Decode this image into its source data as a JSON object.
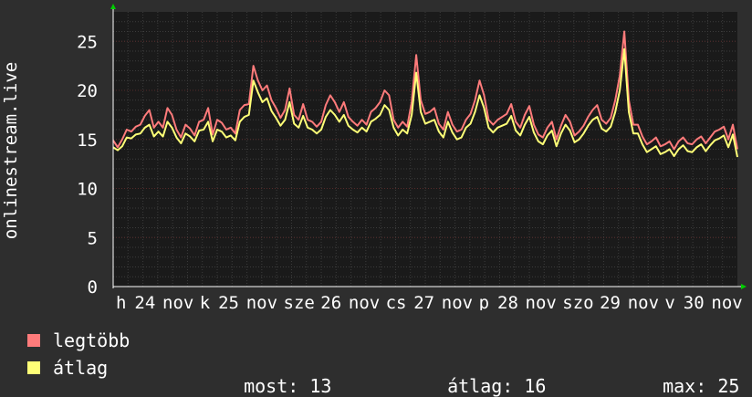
{
  "chart_data": {
    "type": "line",
    "ylabel": "onlinestream.live",
    "ylim": [
      0,
      28
    ],
    "yticks": [
      0,
      5,
      10,
      15,
      20,
      25
    ],
    "x_tick_labels": [
      "h",
      "24",
      "nov",
      "k",
      "25",
      "nov",
      "sze",
      "26",
      "nov",
      "cs",
      "27",
      "nov",
      "p",
      "28",
      "nov",
      "szo",
      "29",
      "nov",
      "v",
      "30",
      "nov"
    ],
    "grid": true,
    "colors": {
      "background": "#2e2e2e",
      "plot_area": "#1a1a1a",
      "grid": "#3c3c3c",
      "axis": "#ffffff",
      "arrow": "#00cc00"
    },
    "series": [
      {
        "name": "legtöbb",
        "color": "#ff7b7b",
        "values": [
          14.9,
          14.2,
          15.0,
          16.0,
          15.8,
          16.3,
          16.5,
          17.4,
          18.0,
          16.2,
          16.8,
          16.2,
          18.2,
          17.5,
          16.0,
          15.2,
          16.5,
          16.1,
          15.4,
          16.8,
          17.0,
          18.2,
          15.5,
          17.0,
          16.7,
          16.0,
          16.2,
          15.6,
          18.0,
          18.5,
          18.6,
          22.5,
          21.0,
          20.0,
          20.5,
          19.0,
          18.2,
          17.2,
          18.0,
          20.2,
          17.5,
          17.0,
          18.6,
          17.0,
          16.8,
          16.3,
          16.8,
          18.5,
          19.5,
          18.8,
          17.8,
          18.8,
          17.3,
          16.8,
          16.4,
          17.0,
          16.5,
          17.8,
          18.2,
          18.8,
          20.0,
          19.5,
          17.0,
          16.2,
          16.8,
          16.3,
          18.8,
          23.6,
          19.0,
          17.6,
          17.8,
          18.2,
          16.6,
          16.0,
          17.8,
          16.5,
          15.8,
          16.0,
          17.0,
          17.6,
          19.0,
          21.0,
          19.5,
          17.0,
          16.5,
          17.0,
          17.3,
          17.6,
          18.6,
          16.8,
          16.2,
          17.5,
          18.4,
          16.5,
          15.5,
          15.2,
          16.2,
          16.8,
          15.0,
          16.4,
          17.5,
          16.8,
          15.4,
          15.8,
          16.4,
          17.3,
          18.0,
          18.5,
          17.0,
          16.6,
          17.2,
          19.0,
          21.5,
          26.0,
          19.0,
          16.5,
          16.5,
          15.3,
          14.5,
          14.8,
          15.2,
          14.3,
          14.5,
          14.8,
          14.0,
          14.8,
          15.2,
          14.6,
          14.5,
          15.0,
          15.3,
          14.6,
          15.2,
          15.8,
          16.0,
          16.3,
          15.0,
          16.5,
          14.0
        ]
      },
      {
        "name": "átlag",
        "color": "#ffff77",
        "values": [
          14.2,
          13.9,
          14.3,
          15.2,
          15.1,
          15.5,
          15.6,
          16.2,
          16.5,
          15.3,
          15.8,
          15.3,
          16.8,
          16.2,
          15.2,
          14.6,
          15.6,
          15.3,
          14.8,
          15.9,
          16.0,
          16.8,
          14.8,
          16.0,
          15.8,
          15.2,
          15.4,
          14.9,
          16.8,
          17.3,
          17.5,
          21.0,
          19.8,
          18.8,
          19.2,
          17.9,
          17.2,
          16.4,
          17.0,
          18.8,
          16.6,
          16.2,
          17.4,
          16.2,
          16.0,
          15.6,
          16.0,
          17.3,
          18.0,
          17.5,
          16.8,
          17.5,
          16.4,
          16.0,
          15.7,
          16.2,
          15.8,
          16.8,
          17.1,
          17.5,
          18.5,
          18.0,
          16.2,
          15.4,
          16.0,
          15.6,
          17.5,
          21.8,
          17.8,
          16.6,
          16.8,
          17.0,
          15.8,
          15.2,
          16.8,
          15.7,
          15.0,
          15.2,
          16.2,
          16.6,
          17.8,
          19.5,
          18.2,
          16.2,
          15.7,
          16.2,
          16.4,
          16.6,
          17.4,
          15.9,
          15.4,
          16.5,
          17.3,
          15.7,
          14.8,
          14.5,
          15.4,
          15.9,
          14.3,
          15.6,
          16.5,
          15.9,
          14.7,
          15.0,
          15.6,
          16.4,
          17.0,
          17.3,
          16.1,
          15.8,
          16.3,
          17.8,
          20.0,
          24.2,
          17.8,
          15.6,
          15.6,
          14.5,
          13.7,
          14.0,
          14.3,
          13.5,
          13.7,
          14.0,
          13.3,
          14.0,
          14.4,
          13.8,
          13.7,
          14.2,
          14.5,
          13.8,
          14.4,
          14.9,
          15.1,
          15.4,
          14.2,
          15.5,
          13.2
        ]
      }
    ]
  },
  "stats": {
    "most_label": "most:",
    "most_value": "13",
    "atlag_label": "átlag:",
    "atlag_value": "16",
    "max_label": "max:",
    "max_value": "25"
  }
}
